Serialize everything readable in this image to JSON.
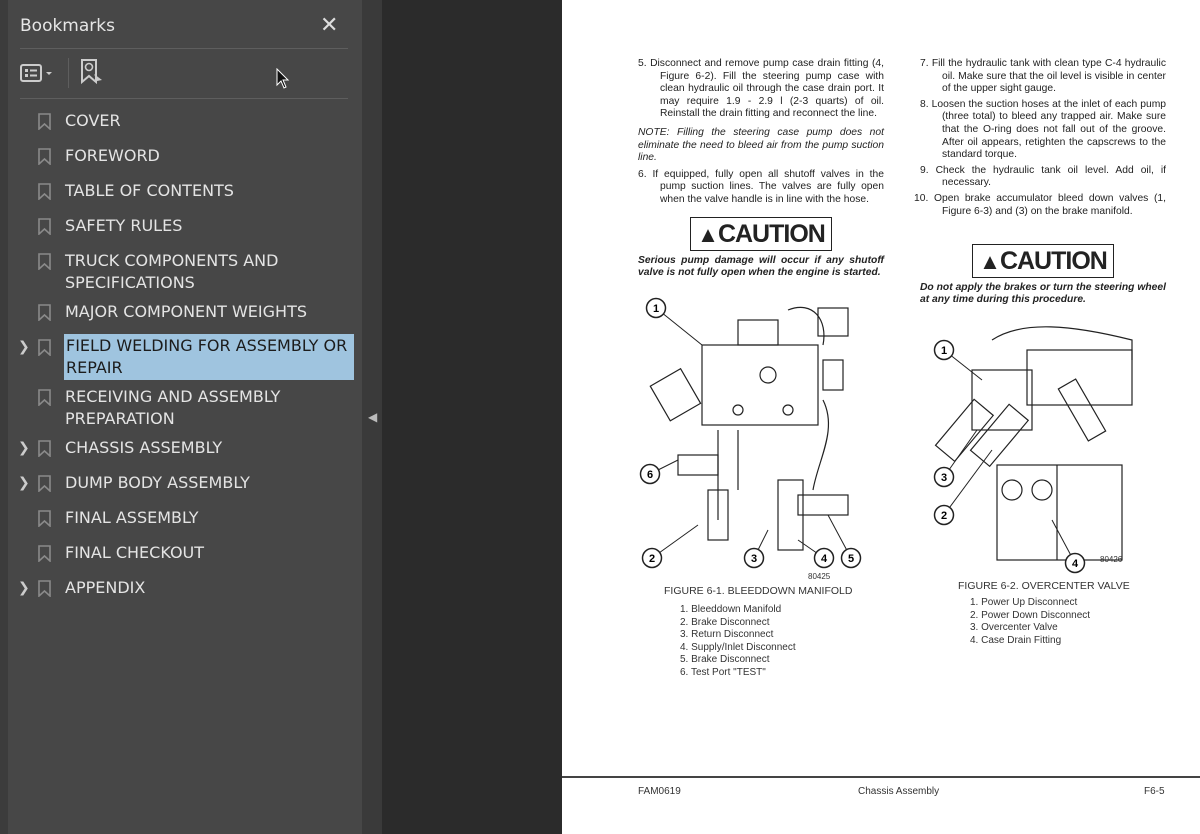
{
  "sidebar": {
    "title": "Bookmarks",
    "close_icon": "close-icon",
    "items": [
      {
        "label": "COVER",
        "expandable": false
      },
      {
        "label": "FOREWORD",
        "expandable": false
      },
      {
        "label": "TABLE OF CONTENTS",
        "expandable": false
      },
      {
        "label": "SAFETY RULES",
        "expandable": false
      },
      {
        "label": "TRUCK COMPONENTS AND SPECIFICATIONS",
        "expandable": false
      },
      {
        "label": "MAJOR COMPONENT WEIGHTS",
        "expandable": false
      },
      {
        "label": "FIELD WELDING FOR ASSEMBLY OR REPAIR",
        "expandable": true,
        "selected": true
      },
      {
        "label": "RECEIVING AND ASSEMBLY PREPARATION",
        "expandable": false
      },
      {
        "label": "CHASSIS  ASSEMBLY",
        "expandable": true
      },
      {
        "label": "DUMP BODY ASSEMBLY",
        "expandable": true
      },
      {
        "label": "FINAL ASSEMBLY",
        "expandable": false
      },
      {
        "label": "FINAL CHECKOUT",
        "expandable": false
      },
      {
        "label": "APPENDIX",
        "expandable": true
      }
    ],
    "selected_color": "#9fc4df"
  },
  "page": {
    "left": {
      "step5": "5. Disconnect and remove pump case drain fitting (4, Figure 6-2). Fill the steering pump case with clean hydraulic oil through the case drain port. It may require 1.9 - 2.9 l (2-3 quarts) of oil. Reinstall the drain fitting and reconnect the line.",
      "note": "NOTE: Filling the steering case pump does not eliminate the need to bleed air from the pump suction line.",
      "step6": "6. If equipped, fully open all shutoff valves in the pump suction lines. The valves are fully open when the valve handle is in line with the hose.",
      "caution": "CAUTION",
      "caution_text": "Serious pump damage will occur if any shutoff valve is not fully open when the engine is started."
    },
    "right": {
      "step7": "7. Fill the hydraulic tank with clean type C-4 hydraulic oil. Make sure that the oil level is visible in center of the upper sight gauge.",
      "step8": "8. Loosen the suction hoses at the inlet of each pump (three total) to bleed any trapped air. Make sure that the O-ring does not fall out of the groove. After oil appears, retighten the capscrews to the standard torque.",
      "step9": "9. Check the hydraulic tank oil level. Add oil, if necessary.",
      "step10": "10. Open brake accumulator bleed down valves (1, Figure 6-3) and (3) on the brake manifold.",
      "caution": "CAUTION",
      "caution_text": "Do not apply the brakes or turn the steering wheel at any time during this procedure."
    },
    "figure1": {
      "caption": "FIGURE 6-1. BLEEDDOWN MANIFOLD",
      "number": "80425",
      "callouts": [
        "1",
        "2",
        "3",
        "4",
        "5",
        "6"
      ],
      "legend": [
        "1. Bleeddown Manifold",
        "2. Brake Disconnect",
        "3. Return Disconnect",
        "4. Supply/Inlet Disconnect",
        "5. Brake Disconnect",
        "6. Test Port \"TEST\""
      ]
    },
    "figure2": {
      "caption": "FIGURE 6-2. OVERCENTER VALVE",
      "number": "80426",
      "callouts": [
        "1",
        "2",
        "3",
        "4"
      ],
      "legend": [
        "1. Power Up Disconnect",
        "2. Power Down Disconnect",
        "3. Overcenter Valve",
        "4. Case Drain Fitting"
      ]
    },
    "footer": {
      "left": "FAM0619",
      "center": "Chassis Assembly",
      "right": "F6-5"
    }
  }
}
